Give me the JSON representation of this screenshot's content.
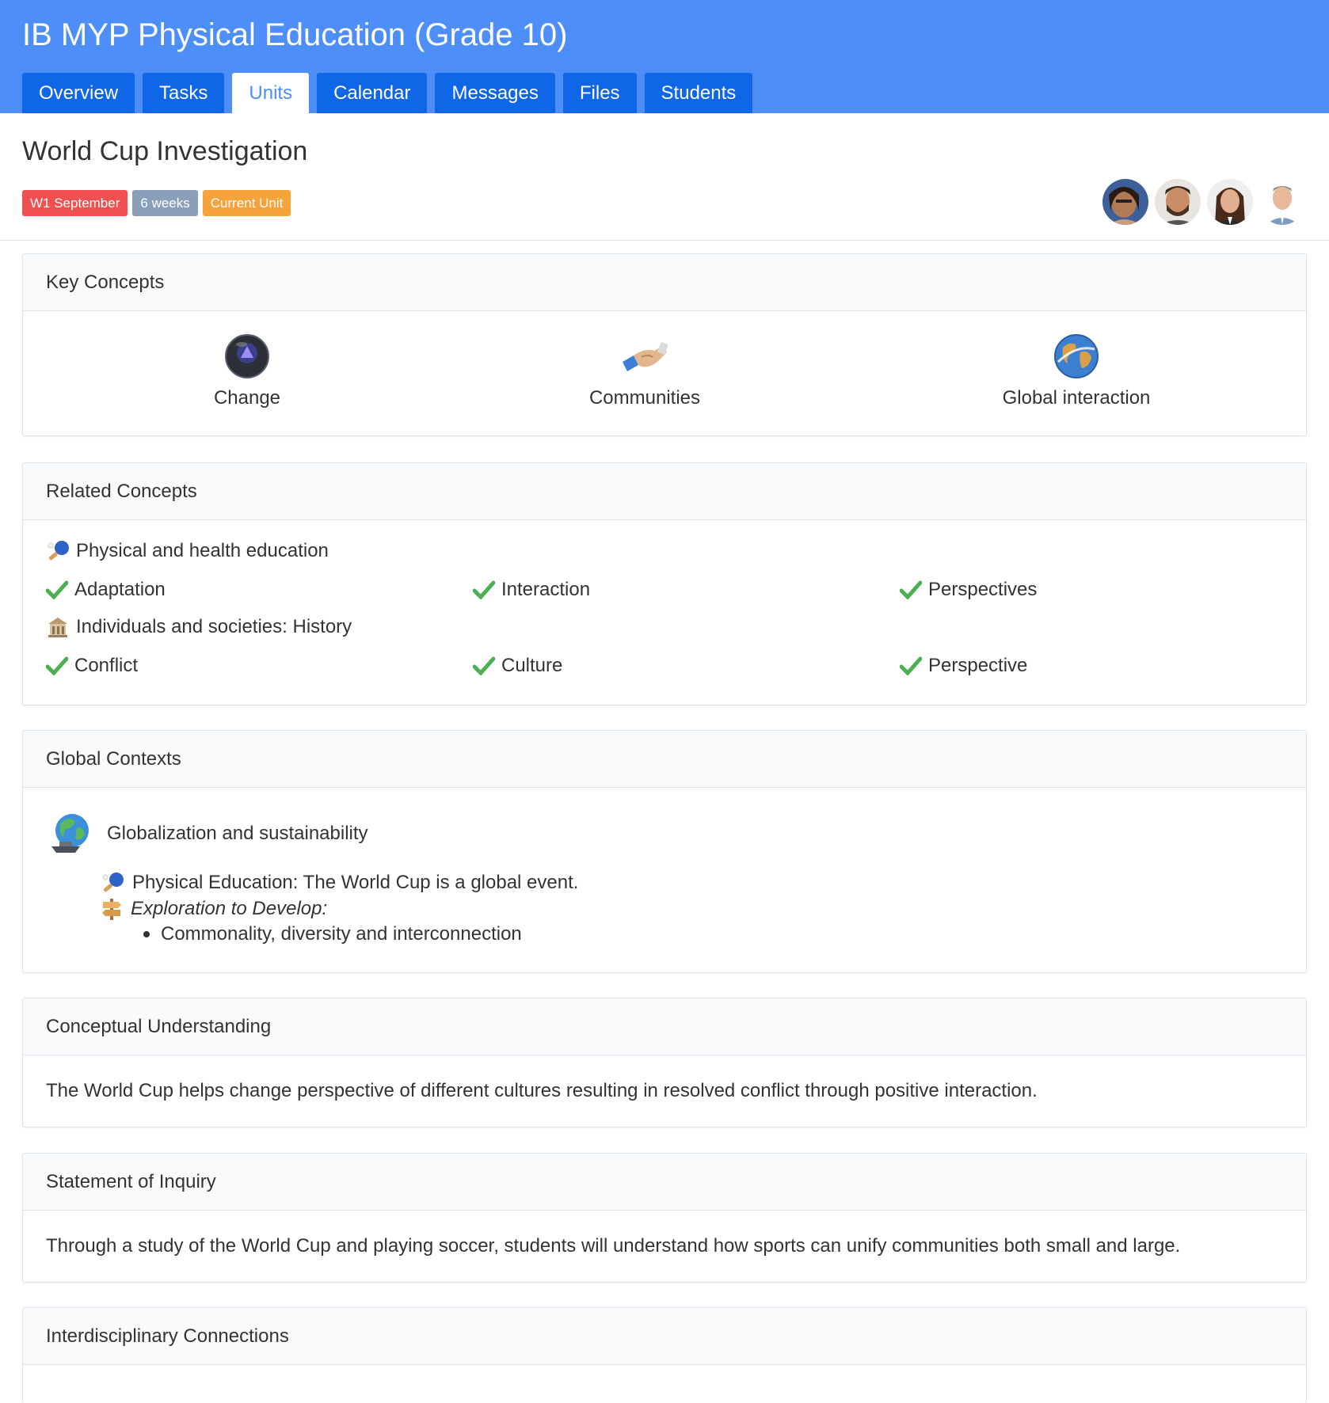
{
  "header": {
    "title": "IB MYP Physical Education (Grade 10)",
    "tabs": [
      {
        "label": "Overview"
      },
      {
        "label": "Tasks"
      },
      {
        "label": "Units"
      },
      {
        "label": "Calendar"
      },
      {
        "label": "Messages"
      },
      {
        "label": "Files"
      },
      {
        "label": "Students"
      }
    ],
    "active_tab": "Units"
  },
  "unit": {
    "title": "World Cup Investigation",
    "badges": {
      "start": "W1 September",
      "duration": "6 weeks",
      "status": "Current Unit"
    },
    "colors": {
      "red": "#f05050",
      "gray": "#8a9fb8",
      "orange": "#f6a33b",
      "accent": "#4d8ef9",
      "tab": "#0f66e6"
    }
  },
  "key_concepts": {
    "heading": "Key Concepts",
    "items": [
      {
        "label": "Change",
        "icon": "magic-8-ball-icon"
      },
      {
        "label": "Communities",
        "icon": "handshake-icon"
      },
      {
        "label": "Global interaction",
        "icon": "globe-icon"
      }
    ]
  },
  "related_concepts": {
    "heading": "Related Concepts",
    "groups": [
      {
        "subject": "Physical and health education",
        "icon": "ping-pong-icon",
        "items": [
          "Adaptation",
          "Interaction",
          "Perspectives"
        ]
      },
      {
        "subject": "Individuals and societies: History",
        "icon": "building-icon",
        "items": [
          "Conflict",
          "Culture",
          "Perspective"
        ]
      }
    ]
  },
  "global_contexts": {
    "heading": "Global Contexts",
    "context": "Globalization and sustainability",
    "statement": "Physical Education: The World Cup is a global event.",
    "exploration_label": "Exploration to Develop:",
    "explorations": [
      "Commonality, diversity and interconnection"
    ]
  },
  "conceptual_understanding": {
    "heading": "Conceptual Understanding",
    "text": "The World Cup helps change perspective of different cultures resulting in resolved conflict through positive interaction."
  },
  "statement_of_inquiry": {
    "heading": "Statement of Inquiry",
    "text": "Through a study of the World Cup and playing soccer, students will understand how sports can unify communities both small and large."
  },
  "interdisciplinary": {
    "heading": "Interdisciplinary Connections"
  }
}
